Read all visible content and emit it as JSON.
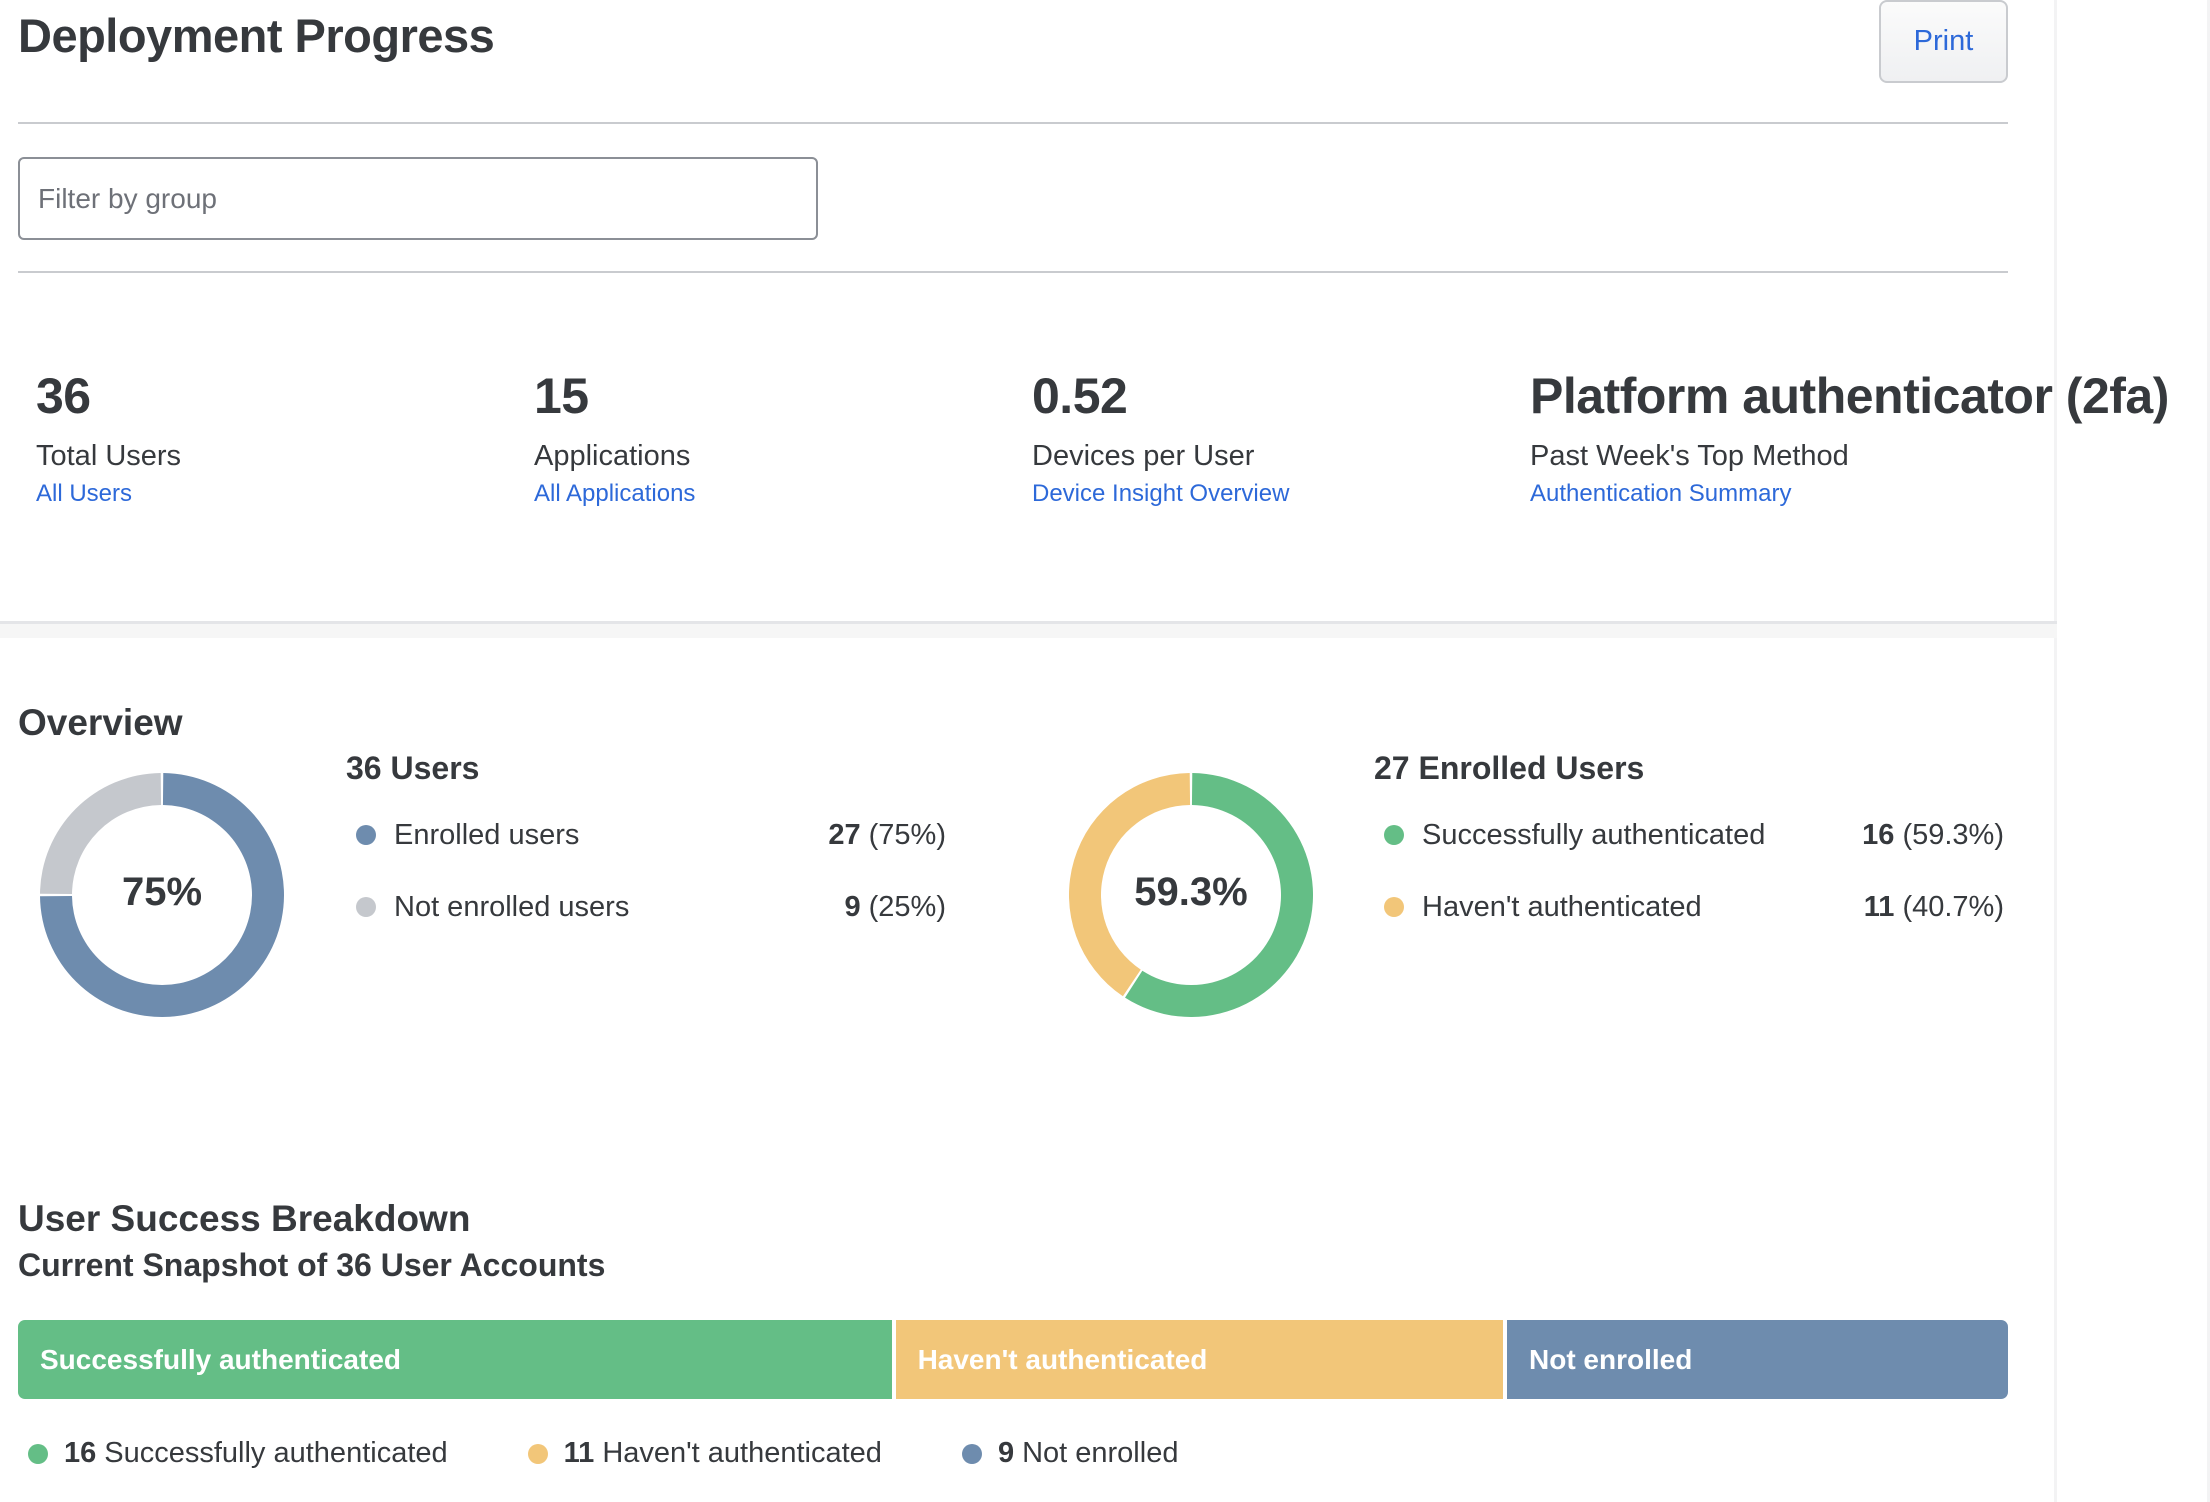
{
  "header": {
    "title": "Deployment Progress",
    "print_label": "Print"
  },
  "filter": {
    "placeholder": "Filter by group",
    "value": ""
  },
  "stats": [
    {
      "value": "36",
      "label": "Total Users",
      "link": "All Users"
    },
    {
      "value": "15",
      "label": "Applications",
      "link": "All Applications"
    },
    {
      "value": "0.52",
      "label": "Devices per User",
      "link": "Device Insight Overview"
    },
    {
      "value": "Platform authenticator (2fa)",
      "label": "Past Week's Top Method",
      "link": "Authentication Summary"
    }
  ],
  "colors": {
    "enrolled": "#6e8cae",
    "not_enrolled": "#c5c8cd",
    "success": "#64be86",
    "pending": "#f2c679",
    "link": "#2d69d9",
    "text": "#36393d"
  },
  "overview": {
    "title": "Overview"
  },
  "chart_data": [
    {
      "type": "pie",
      "variant": "donut",
      "title": "36 Users",
      "center_label": "75%",
      "categories": [
        "Enrolled users",
        "Not enrolled users"
      ],
      "values": [
        27,
        9
      ],
      "percent_labels": [
        "(75%)",
        "(25%)"
      ],
      "colors": [
        "#6e8cae",
        "#c5c8cd"
      ]
    },
    {
      "type": "pie",
      "variant": "donut",
      "title": "27 Enrolled Users",
      "center_label": "59.3%",
      "categories": [
        "Successfully authenticated",
        "Haven't authenticated"
      ],
      "values": [
        16,
        11
      ],
      "percent_labels": [
        "(59.3%)",
        "(40.7%)"
      ],
      "colors": [
        "#64be86",
        "#f2c679"
      ]
    },
    {
      "type": "bar",
      "variant": "stacked-horizontal",
      "title": "User Success Breakdown",
      "subtitle": "Current Snapshot of 36 User Accounts",
      "categories": [
        "Successfully authenticated",
        "Haven't authenticated",
        "Not enrolled"
      ],
      "values": [
        16,
        11,
        9
      ],
      "total": 36,
      "colors": [
        "#64be86",
        "#f2c679",
        "#6e8cae"
      ],
      "legend": [
        "Successfully authenticated",
        "Haven't authenticated",
        "Not enrolled"
      ]
    }
  ]
}
